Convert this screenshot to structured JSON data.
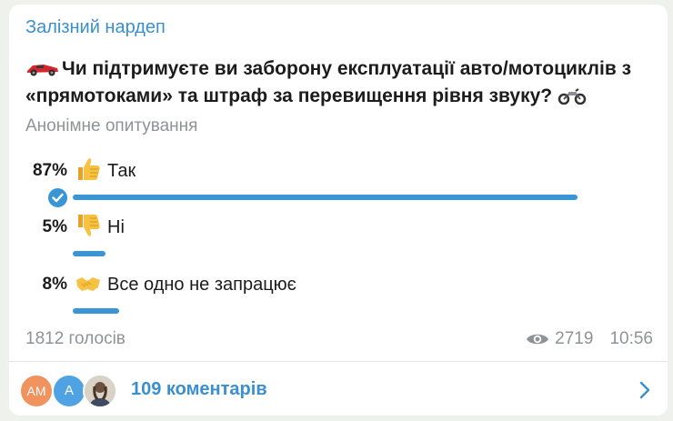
{
  "post": {
    "author": "Залізний нардеп",
    "question": "Чи підтримуєте ви заборону експлуатації авто/мотоциклів з «прямотоками» та штраф за перевищення рівня звуку?",
    "poll_type": "Анонімне опитування",
    "question_emojis": [
      "racing-car-icon",
      "motorcycle-icon"
    ]
  },
  "poll": {
    "options": [
      {
        "percent": "87%",
        "value": 0.87,
        "label": "Так",
        "icon": "thumbs-up-icon",
        "selected": true
      },
      {
        "percent": "5%",
        "value": 0.05,
        "label": "Ні",
        "icon": "thumbs-down-icon",
        "selected": false
      },
      {
        "percent": "8%",
        "value": 0.08,
        "label": "Все одно не запрацює",
        "icon": "handshake-icon",
        "selected": false
      }
    ],
    "bar_color": "#3a95d6"
  },
  "footer": {
    "votes": "1812 голосів",
    "views": "2719",
    "time": "10:56"
  },
  "comments": {
    "avatars": [
      {
        "initials": "AM",
        "color": "#f0935e"
      },
      {
        "initials": "A",
        "color": "#4fa3e3"
      },
      {
        "initials": "",
        "color": "#d9d2c7"
      }
    ],
    "label": "109 коментарів"
  },
  "colors": {
    "accent": "#3a8fcf",
    "muted": "#8e9396",
    "background": "#eef1ec"
  }
}
